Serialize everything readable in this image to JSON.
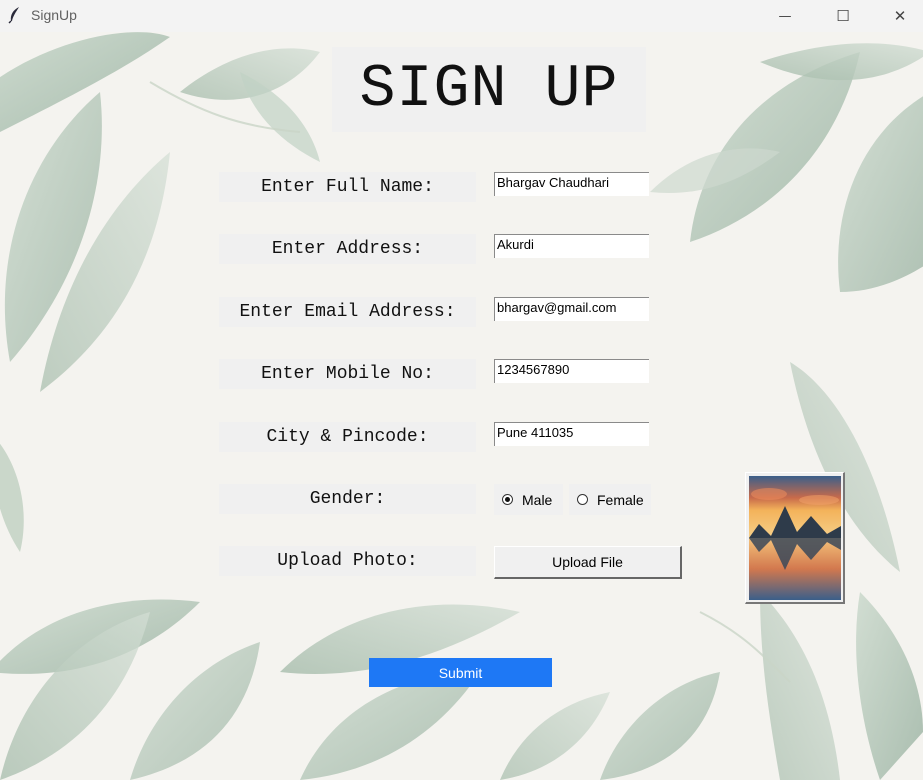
{
  "window": {
    "title": "SignUp",
    "icon": "feather-icon",
    "minimize_glyph": "—",
    "maximize_glyph": "☐",
    "close_glyph": "✕"
  },
  "form": {
    "heading": "SIGN UP",
    "fields": [
      {
        "label": "Enter Full Name:",
        "value": "Bhargav Chaudhari"
      },
      {
        "label": "Enter Address:",
        "value": "Akurdi"
      },
      {
        "label": "Enter Email Address:",
        "value": "bhargav@gmail.com"
      },
      {
        "label": "Enter Mobile No:",
        "value": "1234567890"
      },
      {
        "label": "City & Pincode:",
        "value": "Pune 411035"
      }
    ],
    "gender": {
      "label": "Gender:",
      "options": [
        "Male",
        "Female"
      ],
      "selected": "Male"
    },
    "upload": {
      "label": "Upload Photo:",
      "button_label": "Upload File",
      "preview_icon": "mountain-lake-photo"
    },
    "submit_label": "Submit"
  },
  "colors": {
    "submit_bg": "#1e78f5",
    "leaf": "#b7c9ba",
    "leaf_dark": "#8faa96"
  }
}
